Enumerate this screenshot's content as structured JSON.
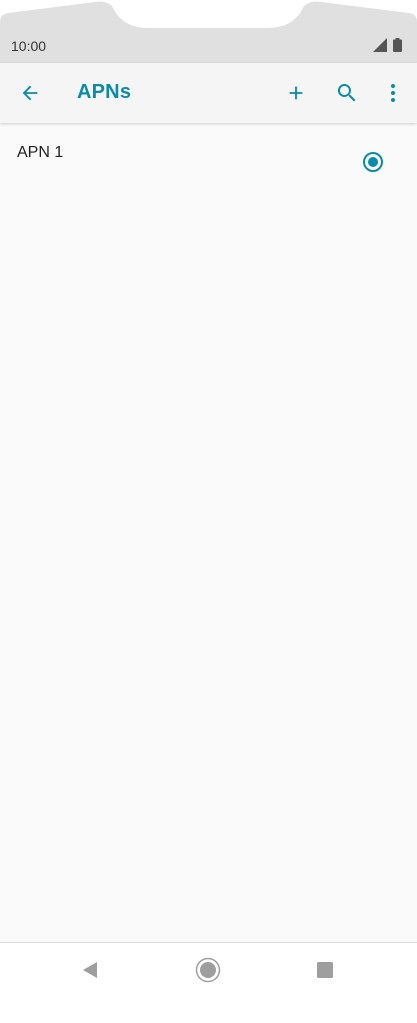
{
  "status_bar": {
    "time": "10:00",
    "icons": [
      "signal-icon",
      "battery-icon"
    ]
  },
  "app_bar": {
    "title": "APNs",
    "back_icon": "arrow-left-icon",
    "actions": [
      "plus-icon",
      "search-icon",
      "more-vert-icon"
    ]
  },
  "apn_list": {
    "items": [
      {
        "label": "APN 1",
        "selected": true
      }
    ]
  },
  "nav_bar": {
    "buttons": [
      "back-triangle-icon",
      "home-circle-icon",
      "recents-square-icon"
    ]
  },
  "colors": {
    "accent": "#0a8ca8",
    "status_bar_bg": "#e0e0e0",
    "app_bar_bg": "#f5f5f5",
    "page_bg": "#fafafa",
    "nav_icon": "#9e9e9e"
  }
}
